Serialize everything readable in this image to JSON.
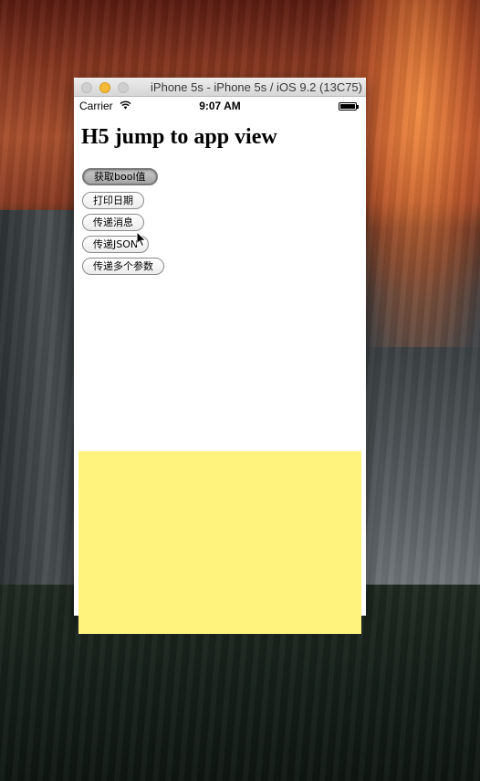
{
  "simulator": {
    "window_title": "iPhone 5s - iPhone 5s / iOS 9.2 (13C75)",
    "accent_color": "#fff27d"
  },
  "status_bar": {
    "carrier": "Carrier",
    "time": "9:07 AM",
    "icons": [
      "wifi-icon",
      "battery-icon"
    ]
  },
  "page": {
    "heading": "H5 jump to app view",
    "buttons": [
      {
        "label": "获取bool值",
        "state": "pressed"
      },
      {
        "label": "打印日期",
        "state": "normal"
      },
      {
        "label": "传递消息",
        "state": "normal"
      },
      {
        "label": "传递JSON",
        "state": "normal"
      },
      {
        "label": "传递多个参数",
        "state": "normal"
      }
    ]
  }
}
